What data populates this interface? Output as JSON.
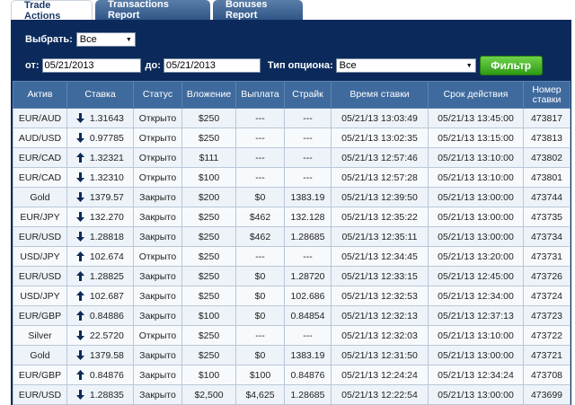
{
  "tabs": [
    "Trade Actions",
    "Transactions Report",
    "Bonuses Report"
  ],
  "filters": {
    "select_label": "Выбрать:",
    "select_value": "Все",
    "from_label": "от:",
    "from_value": "05/21/2013",
    "to_label": "до:",
    "to_value": "05/21/2013",
    "option_type_label": "Тип опциона:",
    "option_type_value": "Все",
    "filter_button": "Фильтр"
  },
  "columns": [
    "Актив",
    "Ставка",
    "Статус",
    "Вложение",
    "Выплата",
    "Страйк",
    "Время ставки",
    "Срок действия",
    "Номер ставки"
  ],
  "rows": [
    {
      "asset": "EUR/AUD",
      "dir": "down",
      "rate": "1.31643",
      "status": "Открыто",
      "invest": "$250",
      "payout": "---",
      "strike": "---",
      "time": "05/21/13 13:03:49",
      "expiry": "05/21/13 13:45:00",
      "id": "473817"
    },
    {
      "asset": "AUD/USD",
      "dir": "down",
      "rate": "0.97785",
      "status": "Открыто",
      "invest": "$250",
      "payout": "---",
      "strike": "---",
      "time": "05/21/13 13:02:35",
      "expiry": "05/21/13 13:15:00",
      "id": "473813"
    },
    {
      "asset": "EUR/CAD",
      "dir": "up",
      "rate": "1.32321",
      "status": "Открыто",
      "invest": "$111",
      "payout": "---",
      "strike": "---",
      "time": "05/21/13 12:57:46",
      "expiry": "05/21/13 13:10:00",
      "id": "473802"
    },
    {
      "asset": "EUR/CAD",
      "dir": "down",
      "rate": "1.32310",
      "status": "Открыто",
      "invest": "$100",
      "payout": "---",
      "strike": "---",
      "time": "05/21/13 12:57:28",
      "expiry": "05/21/13 13:10:00",
      "id": "473801"
    },
    {
      "asset": "Gold",
      "dir": "down",
      "rate": "1379.57",
      "status": "Закрыто",
      "invest": "$200",
      "payout": "$0",
      "strike": "1383.19",
      "time": "05/21/13 12:39:50",
      "expiry": "05/21/13 13:00:00",
      "id": "473744"
    },
    {
      "asset": "EUR/JPY",
      "dir": "down",
      "rate": "132.270",
      "status": "Закрыто",
      "invest": "$250",
      "payout": "$462",
      "strike": "132.128",
      "time": "05/21/13 12:35:22",
      "expiry": "05/21/13 13:00:00",
      "id": "473735"
    },
    {
      "asset": "EUR/USD",
      "dir": "down",
      "rate": "1.28818",
      "status": "Закрыто",
      "invest": "$250",
      "payout": "$462",
      "strike": "1.28685",
      "time": "05/21/13 12:35:11",
      "expiry": "05/21/13 13:00:00",
      "id": "473734"
    },
    {
      "asset": "USD/JPY",
      "dir": "up",
      "rate": "102.674",
      "status": "Открыто",
      "invest": "$250",
      "payout": "---",
      "strike": "---",
      "time": "05/21/13 12:34:45",
      "expiry": "05/21/13 13:20:00",
      "id": "473731"
    },
    {
      "asset": "EUR/USD",
      "dir": "up",
      "rate": "1.28825",
      "status": "Закрыто",
      "invest": "$250",
      "payout": "$0",
      "strike": "1.28720",
      "time": "05/21/13 12:33:15",
      "expiry": "05/21/13 12:45:00",
      "id": "473726"
    },
    {
      "asset": "USD/JPY",
      "dir": "up",
      "rate": "102.687",
      "status": "Закрыто",
      "invest": "$250",
      "payout": "$0",
      "strike": "102.686",
      "time": "05/21/13 12:32:53",
      "expiry": "05/21/13 12:34:00",
      "id": "473724"
    },
    {
      "asset": "EUR/GBP",
      "dir": "up",
      "rate": "0.84886",
      "status": "Закрыто",
      "invest": "$100",
      "payout": "$0",
      "strike": "0.84854",
      "time": "05/21/13 12:32:13",
      "expiry": "05/21/13 12:37:13",
      "id": "473723"
    },
    {
      "asset": "Silver",
      "dir": "down",
      "rate": "22.5720",
      "status": "Открыто",
      "invest": "$250",
      "payout": "---",
      "strike": "---",
      "time": "05/21/13 12:32:03",
      "expiry": "05/21/13 13:10:00",
      "id": "473722"
    },
    {
      "asset": "Gold",
      "dir": "down",
      "rate": "1379.58",
      "status": "Закрыто",
      "invest": "$250",
      "payout": "$0",
      "strike": "1383.19",
      "time": "05/21/13 12:31:50",
      "expiry": "05/21/13 13:00:00",
      "id": "473721"
    },
    {
      "asset": "EUR/GBP",
      "dir": "up",
      "rate": "0.84876",
      "status": "Закрыто",
      "invest": "$100",
      "payout": "$100",
      "strike": "0.84876",
      "time": "05/21/13 12:24:24",
      "expiry": "05/21/13 12:34:24",
      "id": "473708"
    },
    {
      "asset": "EUR/USD",
      "dir": "down",
      "rate": "1.28835",
      "status": "Закрыто",
      "invest": "$2,500",
      "payout": "$4,625",
      "strike": "1.28685",
      "time": "05/21/13 12:22:54",
      "expiry": "05/21/13 13:00:00",
      "id": "473699"
    }
  ],
  "colors": {
    "panel": "#0b2a5b",
    "header": "#3f6a9d",
    "filter_button": "#2e9a16"
  }
}
